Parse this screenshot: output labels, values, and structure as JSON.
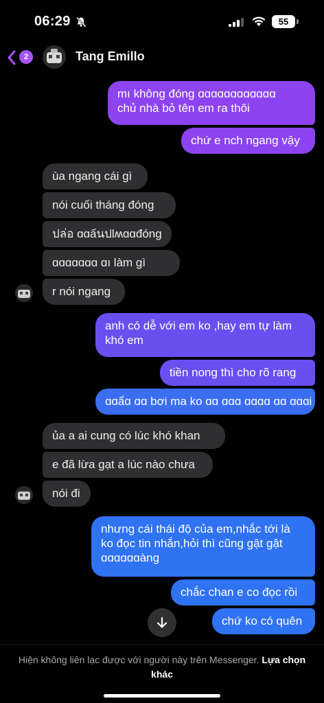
{
  "status_bar": {
    "time": "06:29",
    "battery": "55"
  },
  "header": {
    "unread_count": "2",
    "contact_name": "Tang Emillo"
  },
  "messages": [
    {
      "text": "mı không đóng ɑɑɑɑɑɑɑɑɑɑɑɑ",
      "text2": "chủ nhà bỏ tên em ra thôi"
    },
    {
      "text": "chứ e nch ngang vậy"
    },
    {
      "text": "ùa ngang cái gì"
    },
    {
      "text": "nói cuối tháng đóng"
    },
    {
      "text": "ปล่อ ɑɑấนปlʍɑɑđóng"
    },
    {
      "text": "ɑɑɑɑɑɑɑ ɑı làm gì"
    },
    {
      "text": "r nói ngang"
    },
    {
      "text": "anh có dễ với em ko ,hay em tự làm",
      "text2": "khó em"
    },
    {
      "text": "tiền nong thì cho rõ rang"
    },
    {
      "text": "ɑɑẩɑ ɑɑ bơi ma ko ɑɑ ɑɑɑ ɑɑɑɑ ɑɑ ɑɑɑi"
    },
    {
      "text": "ủa a ai cung  có lúc khó khan"
    },
    {
      "text": "e đã lừa gạt a lúc nào chưa"
    },
    {
      "text": "nói đi"
    },
    {
      "text": "nhưng cái thái độ của em,nhắc tới là",
      "text2": "ko đọc tin nhắn,hỏi thì cũng gật gật",
      "text3": "ɑɑɑɑɑɑàng"
    },
    {
      "text": "chắc chan e co đọc rồi"
    },
    {
      "text": "chứ ko có quên"
    }
  ],
  "footer": {
    "notice": "Hiện không liên lạc được với người này trên Messenger. ",
    "link": "Lựa chọn khác"
  },
  "colors": {
    "incoming": "#2f2f32",
    "outgoing_purple": "#8d44f0",
    "outgoing_blue": "#3a6df0",
    "badge": "#a855f7"
  },
  "icons": [
    "bell-slash-icon",
    "signal-icon",
    "wifi-icon",
    "battery-icon",
    "back-chevron-icon",
    "chevron-down-icon"
  ]
}
